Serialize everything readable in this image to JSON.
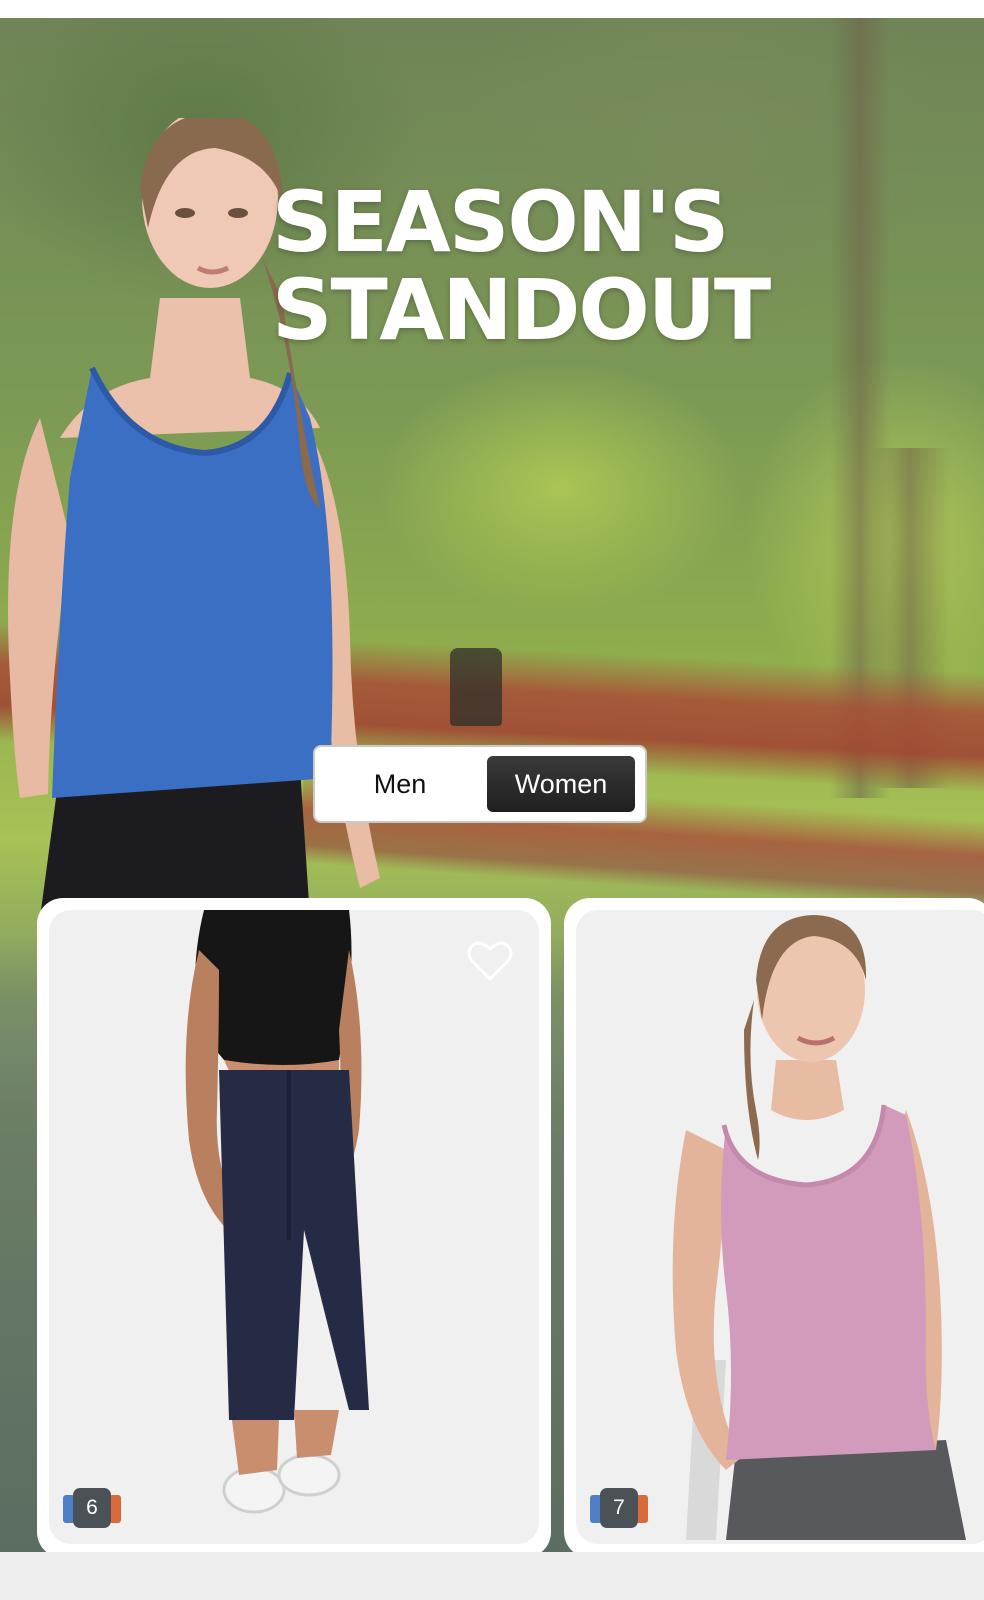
{
  "hero": {
    "headline_line1": "SEASON'S",
    "headline_line2": "STANDOUT"
  },
  "gender_toggle": {
    "men_label": "Men",
    "women_label": "Women",
    "selected": "Women"
  },
  "products": [
    {
      "image": "woman in black crop top and navy wide-leg pants",
      "colors_count": "6",
      "swatch_colors": [
        "#4f7fc4",
        "#d86a3c"
      ],
      "wishlist_icon": "heart-icon"
    },
    {
      "image": "woman in pink tank top",
      "colors_count": "7",
      "swatch_colors": [
        "#4f7fc4",
        "#d86a3c"
      ]
    }
  ],
  "colors": {
    "toggle_selected_bg": "#2a2a2a",
    "hero_tank_top": "#3a6fc4",
    "card_bg": "#f0f0f0"
  }
}
